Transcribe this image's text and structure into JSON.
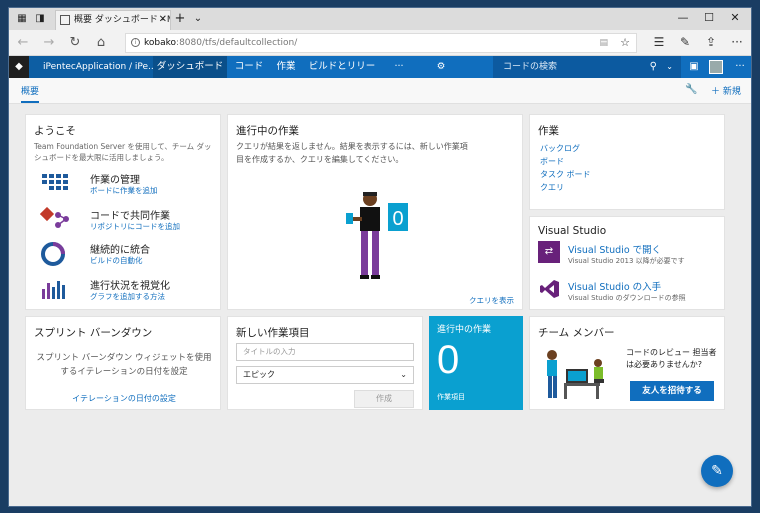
{
  "browser": {
    "tab_title": "概要 ダッシュボード - Micr",
    "url_host": "kobako",
    "url_rest": ":8080/tfs/defaultcollection/",
    "new_tab": "+",
    "tab_list": "⌄"
  },
  "topnav": {
    "project": "iPentecApplication / iPe...",
    "items": [
      "ダッシュボード",
      "コード",
      "作業",
      "ビルドとリリース",
      "···"
    ],
    "search_placeholder": "コードの検索"
  },
  "subnav": {
    "overview": "概要",
    "new_label": "新規"
  },
  "welcome": {
    "title": "ようこそ",
    "desc": "Team Foundation Server を使用して、チーム ダッシュボードを最大限に活用しましょう。",
    "features": [
      {
        "title": "作業の管理",
        "sub": "ボードに作業を追加"
      },
      {
        "title": "コードで共同作業",
        "sub": "リポジトリにコードを追加"
      },
      {
        "title": "継続的に統合",
        "sub": "ビルドの自動化"
      },
      {
        "title": "進行状況を視覚化",
        "sub": "グラフを追加する方法"
      }
    ]
  },
  "work_in_progress": {
    "title": "進行中の作業",
    "desc": "クエリが結果を返しません。結果を表示するには、新しい作業項目を作成するか、クエリを編集してください。",
    "badge": "0",
    "link": "クエリを表示"
  },
  "work_links": {
    "title": "作業",
    "links": [
      "バックログ",
      "ボード",
      "タスク ボード",
      "クエリ"
    ]
  },
  "visual_studio": {
    "title": "Visual Studio",
    "open_title": "Visual Studio で開く",
    "open_sub": "Visual Studio 2013 以降が必要です",
    "get_title": "Visual Studio の入手",
    "get_sub": "Visual Studio のダウンロードの参照"
  },
  "sprint": {
    "title": "スプリント バーンダウン",
    "desc": "スプリント バーンダウン ウィジェットを使用するイテレーションの日付を設定",
    "link": "イテレーションの日付の設定"
  },
  "new_item": {
    "title": "新しい作業項目",
    "placeholder": "タイトルの入力",
    "type_value": "エピック",
    "create_label": "作成"
  },
  "wip_count": {
    "title": "進行中の作業",
    "count": "0",
    "sub": "作業項目"
  },
  "team": {
    "title": "チーム メンバー",
    "review": "コードのレビュー 担当者は必要ありませんか?",
    "invite": "友人を招待する"
  },
  "colors": {
    "accent": "#106ebe",
    "wip_tile": "#0aa0d0"
  }
}
